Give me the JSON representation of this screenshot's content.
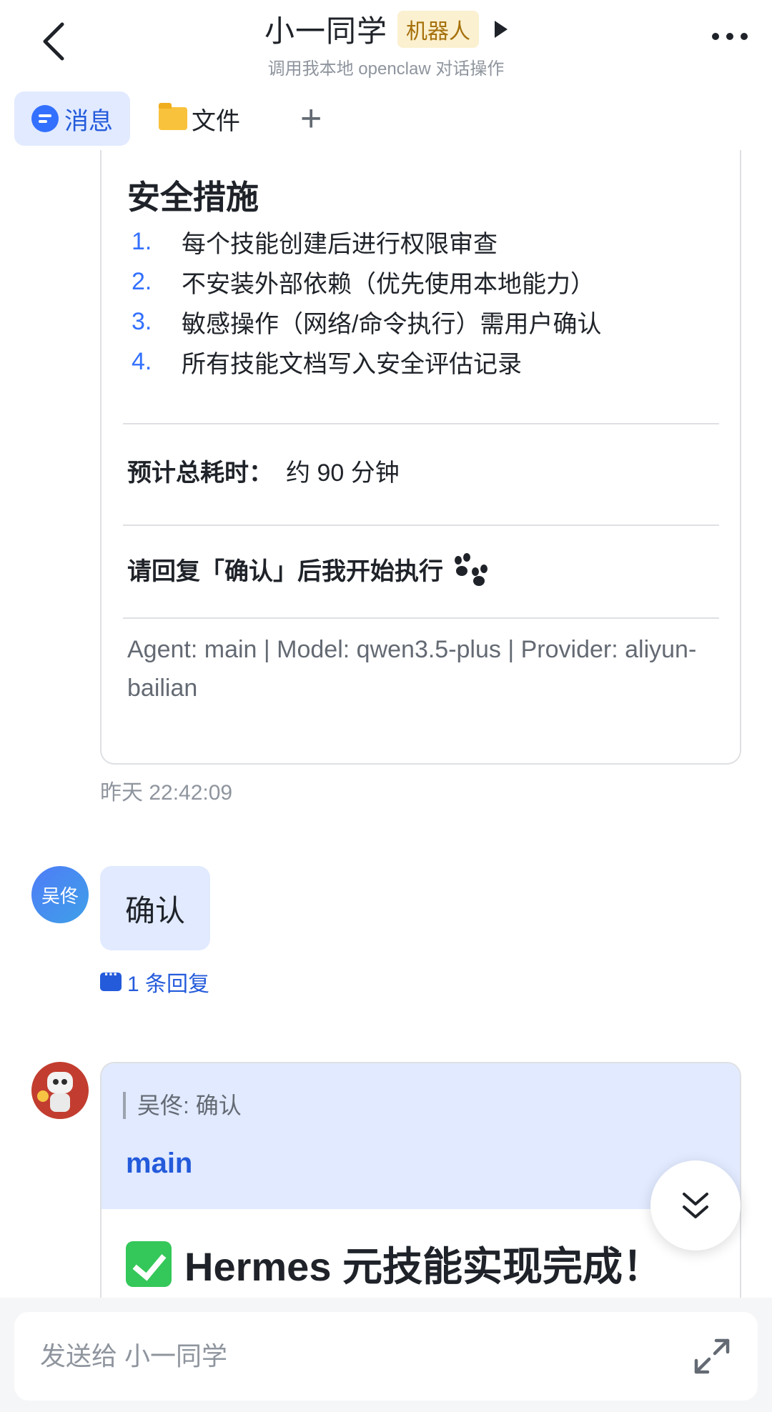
{
  "header": {
    "title": "小一同学",
    "badge": "机器人",
    "subtitle": "调用我本地 openclaw 对话操作"
  },
  "tabs": [
    {
      "label": "消息",
      "icon": "message-icon",
      "active": true
    },
    {
      "label": "文件",
      "icon": "folder-icon",
      "active": false
    },
    {
      "label": "+",
      "icon": "add-icon",
      "active": false
    }
  ],
  "card1": {
    "section_title": "安全措施",
    "items": [
      {
        "num": "1.",
        "text": "每个技能创建后进行权限审查"
      },
      {
        "num": "2.",
        "text": "不安装外部依赖（优先使用本地能力）"
      },
      {
        "num": "3.",
        "text": "敏感操作（网络/命令执行）需用户确认"
      },
      {
        "num": "4.",
        "text": "所有技能文档写入安全评估记录"
      }
    ],
    "estimate_label": "预计总耗时：",
    "estimate_value": "约 90 分钟",
    "confirm_request": "请回复「确认」后我开始执行",
    "agent_meta": "Agent: main | Model: qwen3.5-plus | Provider: aliyun-bailian"
  },
  "timestamp1": "昨天 22:42:09",
  "message_user": {
    "avatar_text": "吴佟",
    "text": "确认",
    "reply_count": "1 条回复"
  },
  "message_bot": {
    "quote": "吴佟: 确认",
    "agent": "main",
    "title": "Hermes 元技能实现完成！"
  },
  "input": {
    "placeholder": "发送给 小一同学"
  },
  "colors": {
    "accent": "#3370ff",
    "bubble": "#e1eaff",
    "badge_bg": "#fbf0cf",
    "badge_text": "#a6710c"
  }
}
